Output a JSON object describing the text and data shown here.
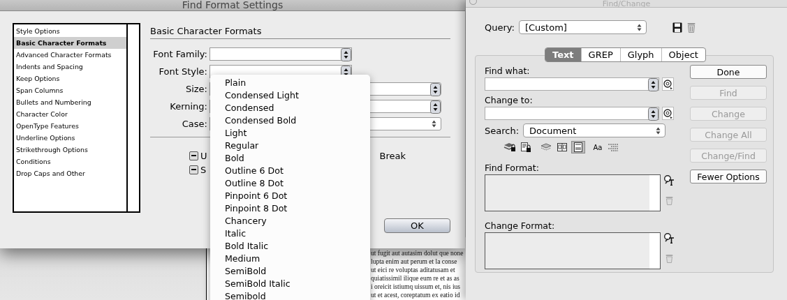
{
  "find_format_dialog": {
    "title": "Find Format Settings",
    "categories": [
      {
        "label": "Style Options",
        "selected": false
      },
      {
        "label": "Basic Character Formats",
        "selected": true
      },
      {
        "label": "Advanced Character Formats",
        "selected": false
      },
      {
        "label": "Indents and Spacing",
        "selected": false
      },
      {
        "label": "Keep Options",
        "selected": false
      },
      {
        "label": "Span Columns",
        "selected": false
      },
      {
        "label": "Bullets and Numbering",
        "selected": false
      },
      {
        "label": "Character Color",
        "selected": false
      },
      {
        "label": "OpenType Features",
        "selected": false
      },
      {
        "label": "Underline Options",
        "selected": false
      },
      {
        "label": "Strikethrough Options",
        "selected": false
      },
      {
        "label": "Conditions",
        "selected": false
      },
      {
        "label": "Drop Caps and Other",
        "selected": false
      }
    ],
    "section_title": "Basic Character Formats",
    "fields": [
      {
        "label": "Font Family:",
        "kind": "combo"
      },
      {
        "label": "Font Style:",
        "kind": "combo"
      },
      {
        "label": "Size:",
        "kind": "stepper"
      },
      {
        "label": "Kerning:",
        "kind": "stepper"
      },
      {
        "label": "Case:",
        "kind": "popup"
      }
    ],
    "checkboxes": [
      {
        "label": "U",
        "mixed": true
      },
      {
        "label": "S",
        "mixed": true
      }
    ],
    "side_checkbox_label": "Break",
    "ok_button": "OK"
  },
  "font_style_menu": {
    "items": [
      "Plain",
      "Condensed Light",
      "Condensed",
      "Condensed Bold",
      "Light",
      "Regular",
      "Bold",
      "Outline 6 Dot",
      "Outline 8 Dot",
      "Pinpoint 6 Dot",
      "Pinpoint 8 Dot",
      "Chancery",
      "Italic",
      "Bold Italic",
      "Medium",
      "SemiBold",
      "SemiBold Italic",
      "Semibold"
    ]
  },
  "document_text": [
    "ut fugit aut autasim dolut que none",
    "lupta enim aut perum et la conse",
    "ut eici re voluptas aditatusam et",
    "quiatissimil ilique eum re et as as",
    "i oreicit istiumq uissum et, nis ius",
    "ut et acest, coreptatum ex eatio id"
  ],
  "find_change": {
    "title": "Find/Change",
    "query_label": "Query:",
    "query_value": "[Custom]",
    "tabs": [
      {
        "label": "Text",
        "selected": true
      },
      {
        "label": "GREP",
        "selected": false
      },
      {
        "label": "Glyph",
        "selected": false
      },
      {
        "label": "Object",
        "selected": false
      }
    ],
    "find_what_label": "Find what:",
    "change_to_label": "Change to:",
    "search_label": "Search:",
    "search_value": "Document",
    "search_options": [
      {
        "kind": "locked-layers",
        "selected": false
      },
      {
        "kind": "locked-stories",
        "selected": false
      },
      {
        "kind": "hidden-layers",
        "selected": false
      },
      {
        "kind": "master-pages",
        "selected": false
      },
      {
        "kind": "footnotes",
        "selected": true
      },
      {
        "kind": "case",
        "text": "Aa",
        "selected": false
      },
      {
        "kind": "whole-word",
        "selected": false
      }
    ],
    "buttons": [
      {
        "label": "Done",
        "disabled": false
      },
      {
        "label": "Find",
        "disabled": true
      },
      {
        "label": "Change",
        "disabled": true
      },
      {
        "label": "Change All",
        "disabled": true
      },
      {
        "label": "Change/Find",
        "disabled": true
      },
      {
        "label": "Fewer Options",
        "disabled": false
      }
    ],
    "find_format_label": "Find Format:",
    "change_format_label": "Change Format:"
  }
}
